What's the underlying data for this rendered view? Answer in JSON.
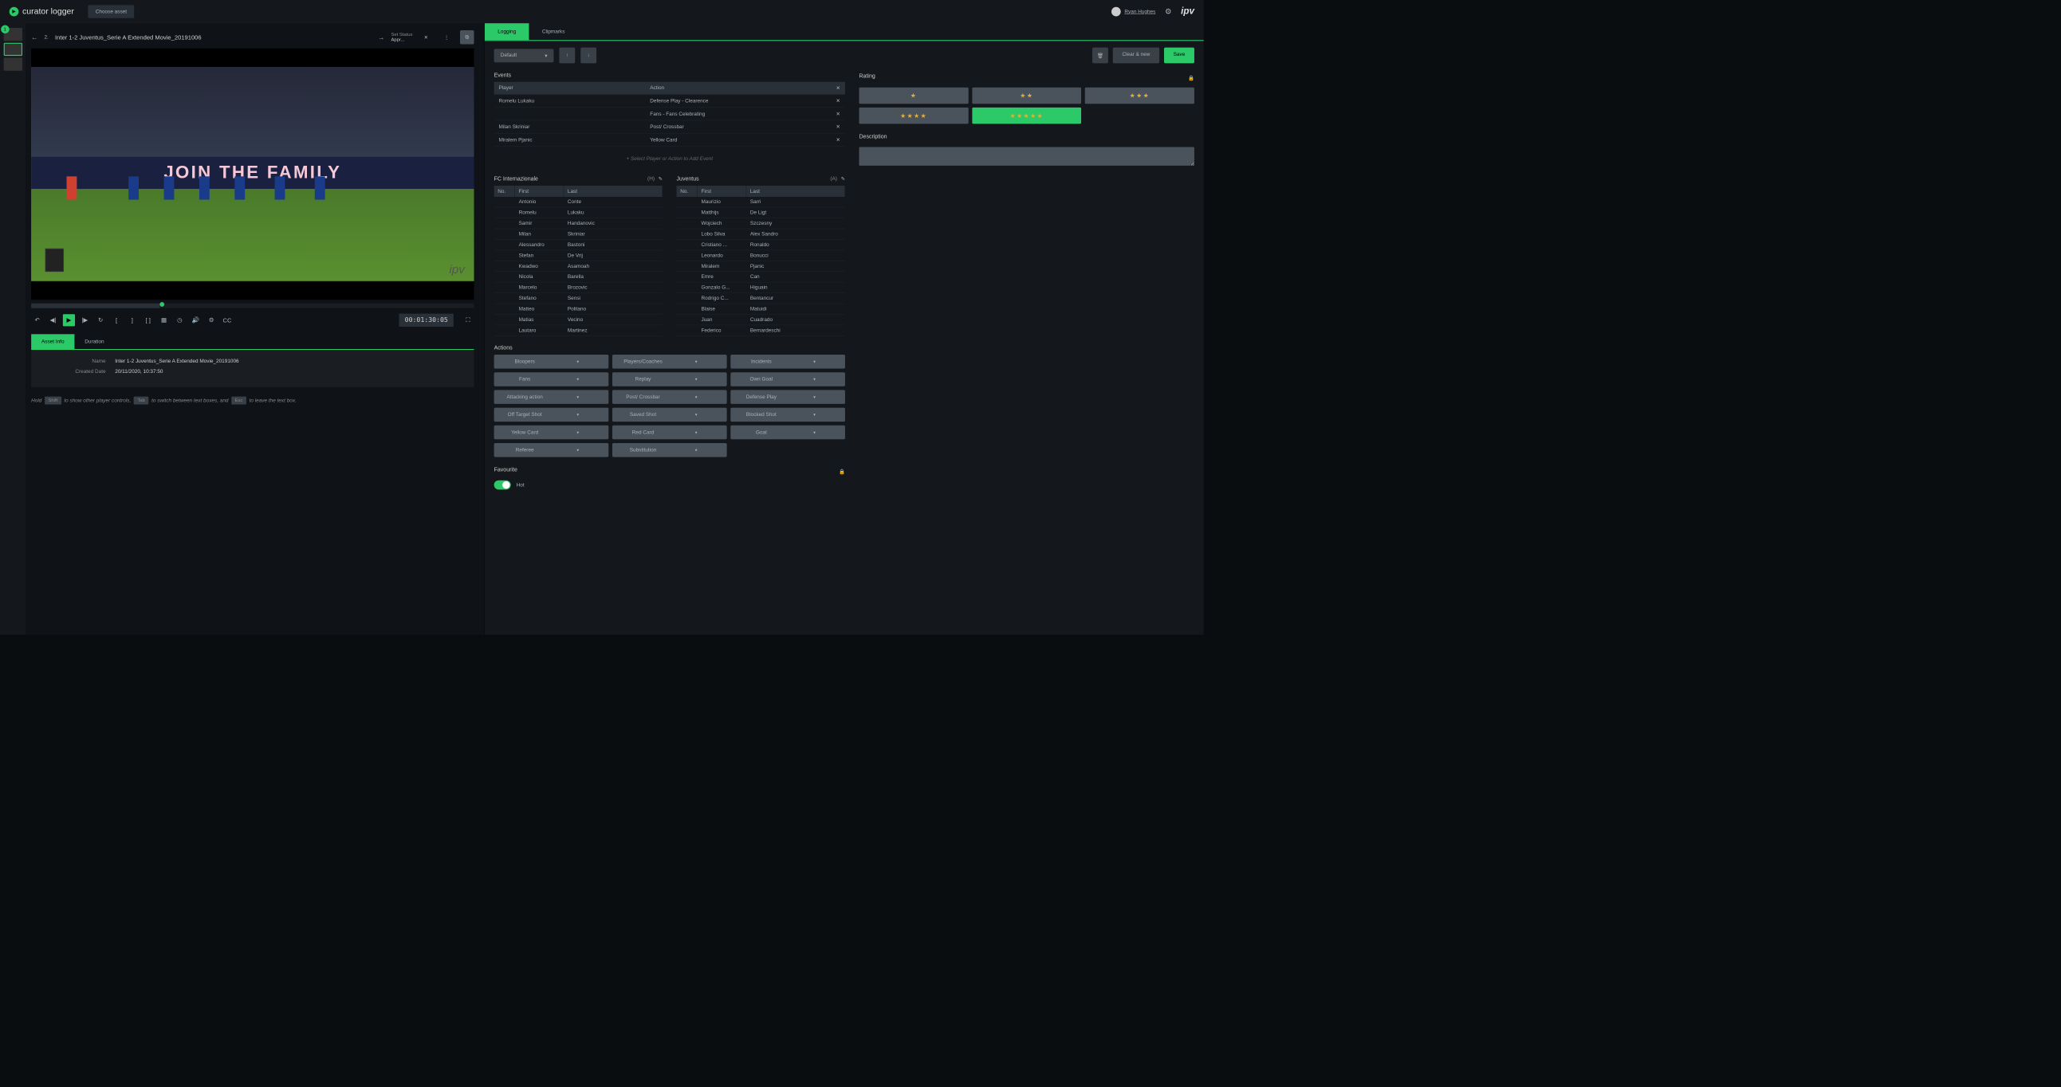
{
  "brand": "curator logger",
  "chooseAsset": "Choose asset",
  "user": "Ryan Hughes",
  "ipv": "ipv",
  "rail": {
    "badge": "1"
  },
  "asset": {
    "prefix": "2.",
    "title": "Inter 1-2 Juventus_Serie A Extended Movie_20191006",
    "statusLabel": "Set Status",
    "statusValue": "Appr..."
  },
  "banner": "JOIN THE FAMILY",
  "timecode": "00:01:30:05",
  "lowerTabs": {
    "info": "Asset Info",
    "duration": "Duration"
  },
  "info": {
    "nameLabel": "Name",
    "nameVal": "Inter 1-2 Juventus_Serie A Extended Movie_20191006",
    "dateLabel": "Created Date",
    "dateVal": "20/11/2020, 10:37:50"
  },
  "hint": {
    "t1": "Hold",
    "k1": "Shift",
    "t2": "to show other player controls,",
    "k2": "Tab",
    "t3": "to switch between text boxes, and",
    "k3": "Esc",
    "t4": "to leave the text box."
  },
  "upperTabs": {
    "logging": "Logging",
    "clipmarks": "Clipmarks"
  },
  "default": "Default",
  "buttons": {
    "clear": "Clear & new",
    "save": "Save"
  },
  "eventsH": "Events",
  "evHead": {
    "player": "Player",
    "action": "Action"
  },
  "events": [
    {
      "player": "Romelu Lukaku",
      "action": "Defense Play - Clearence"
    },
    {
      "player": "",
      "action": "Fans - Fans Celebrating"
    },
    {
      "player": "Milan Skriniar",
      "action": "Post/ Crossbar"
    },
    {
      "player": "Miralem Pjanic",
      "action": "Yellow Card"
    }
  ],
  "addEvent": "+ Select Player or Action to Add Event",
  "rHead": {
    "no": "No.",
    "first": "First",
    "last": "Last"
  },
  "teamH": {
    "name": "FC Internazionale",
    "side": "(H)",
    "roster": [
      {
        "f": "Antonio",
        "l": "Conte"
      },
      {
        "f": "Romelu",
        "l": "Lukaku"
      },
      {
        "f": "Samir",
        "l": "Handanovic"
      },
      {
        "f": "Milan",
        "l": "Skriniar"
      },
      {
        "f": "Alessandro",
        "l": "Bastoni"
      },
      {
        "f": "Stefan",
        "l": "De Vrij"
      },
      {
        "f": "Kwadwo",
        "l": "Asamoah"
      },
      {
        "f": "Nicola",
        "l": "Barella"
      },
      {
        "f": "Marcelo",
        "l": "Brozovic"
      },
      {
        "f": "Stefano",
        "l": "Sensi"
      },
      {
        "f": "Matteo",
        "l": "Politano"
      },
      {
        "f": "Matias",
        "l": "Vecino"
      },
      {
        "f": "Lautaro",
        "l": "Martinez"
      }
    ]
  },
  "teamA": {
    "name": "Juventus",
    "side": "(A)",
    "roster": [
      {
        "f": "Maurizio",
        "l": "Sarri"
      },
      {
        "f": "Matthijs",
        "l": "De Ligt"
      },
      {
        "f": "Wojciech",
        "l": "Szczesny"
      },
      {
        "f": "Lobo Silva",
        "l": "Alex Sandro"
      },
      {
        "f": "Cristiano ...",
        "l": "Ronaldo"
      },
      {
        "f": "Leonardo",
        "l": "Bonucci"
      },
      {
        "f": "Miralem",
        "l": "Pjanic"
      },
      {
        "f": "Emre",
        "l": "Can"
      },
      {
        "f": "Gonzalo G...",
        "l": "Higuain"
      },
      {
        "f": "Rodrigo C...",
        "l": "Bentancur"
      },
      {
        "f": "Blaise",
        "l": "Matuidi"
      },
      {
        "f": "Juan",
        "l": "Cuadrado"
      },
      {
        "f": "Federico",
        "l": "Bernardeschi"
      }
    ]
  },
  "actionsH": "Actions",
  "actions": [
    "Bloopers",
    "Players/Coaches",
    "Incidents",
    "Fans",
    "Replay",
    "Own Goal",
    "Attacking action",
    "Post/ Crossbar",
    "Defense Play",
    "Off Target Shot",
    "Saved Shot",
    "Blocked Shot",
    "Yellow Card",
    "Red Card",
    "Goal",
    "Referee",
    "Substitution"
  ],
  "favH": "Favourite",
  "favLabel": "Hot",
  "ratingH": "Rating",
  "descH": "Description"
}
